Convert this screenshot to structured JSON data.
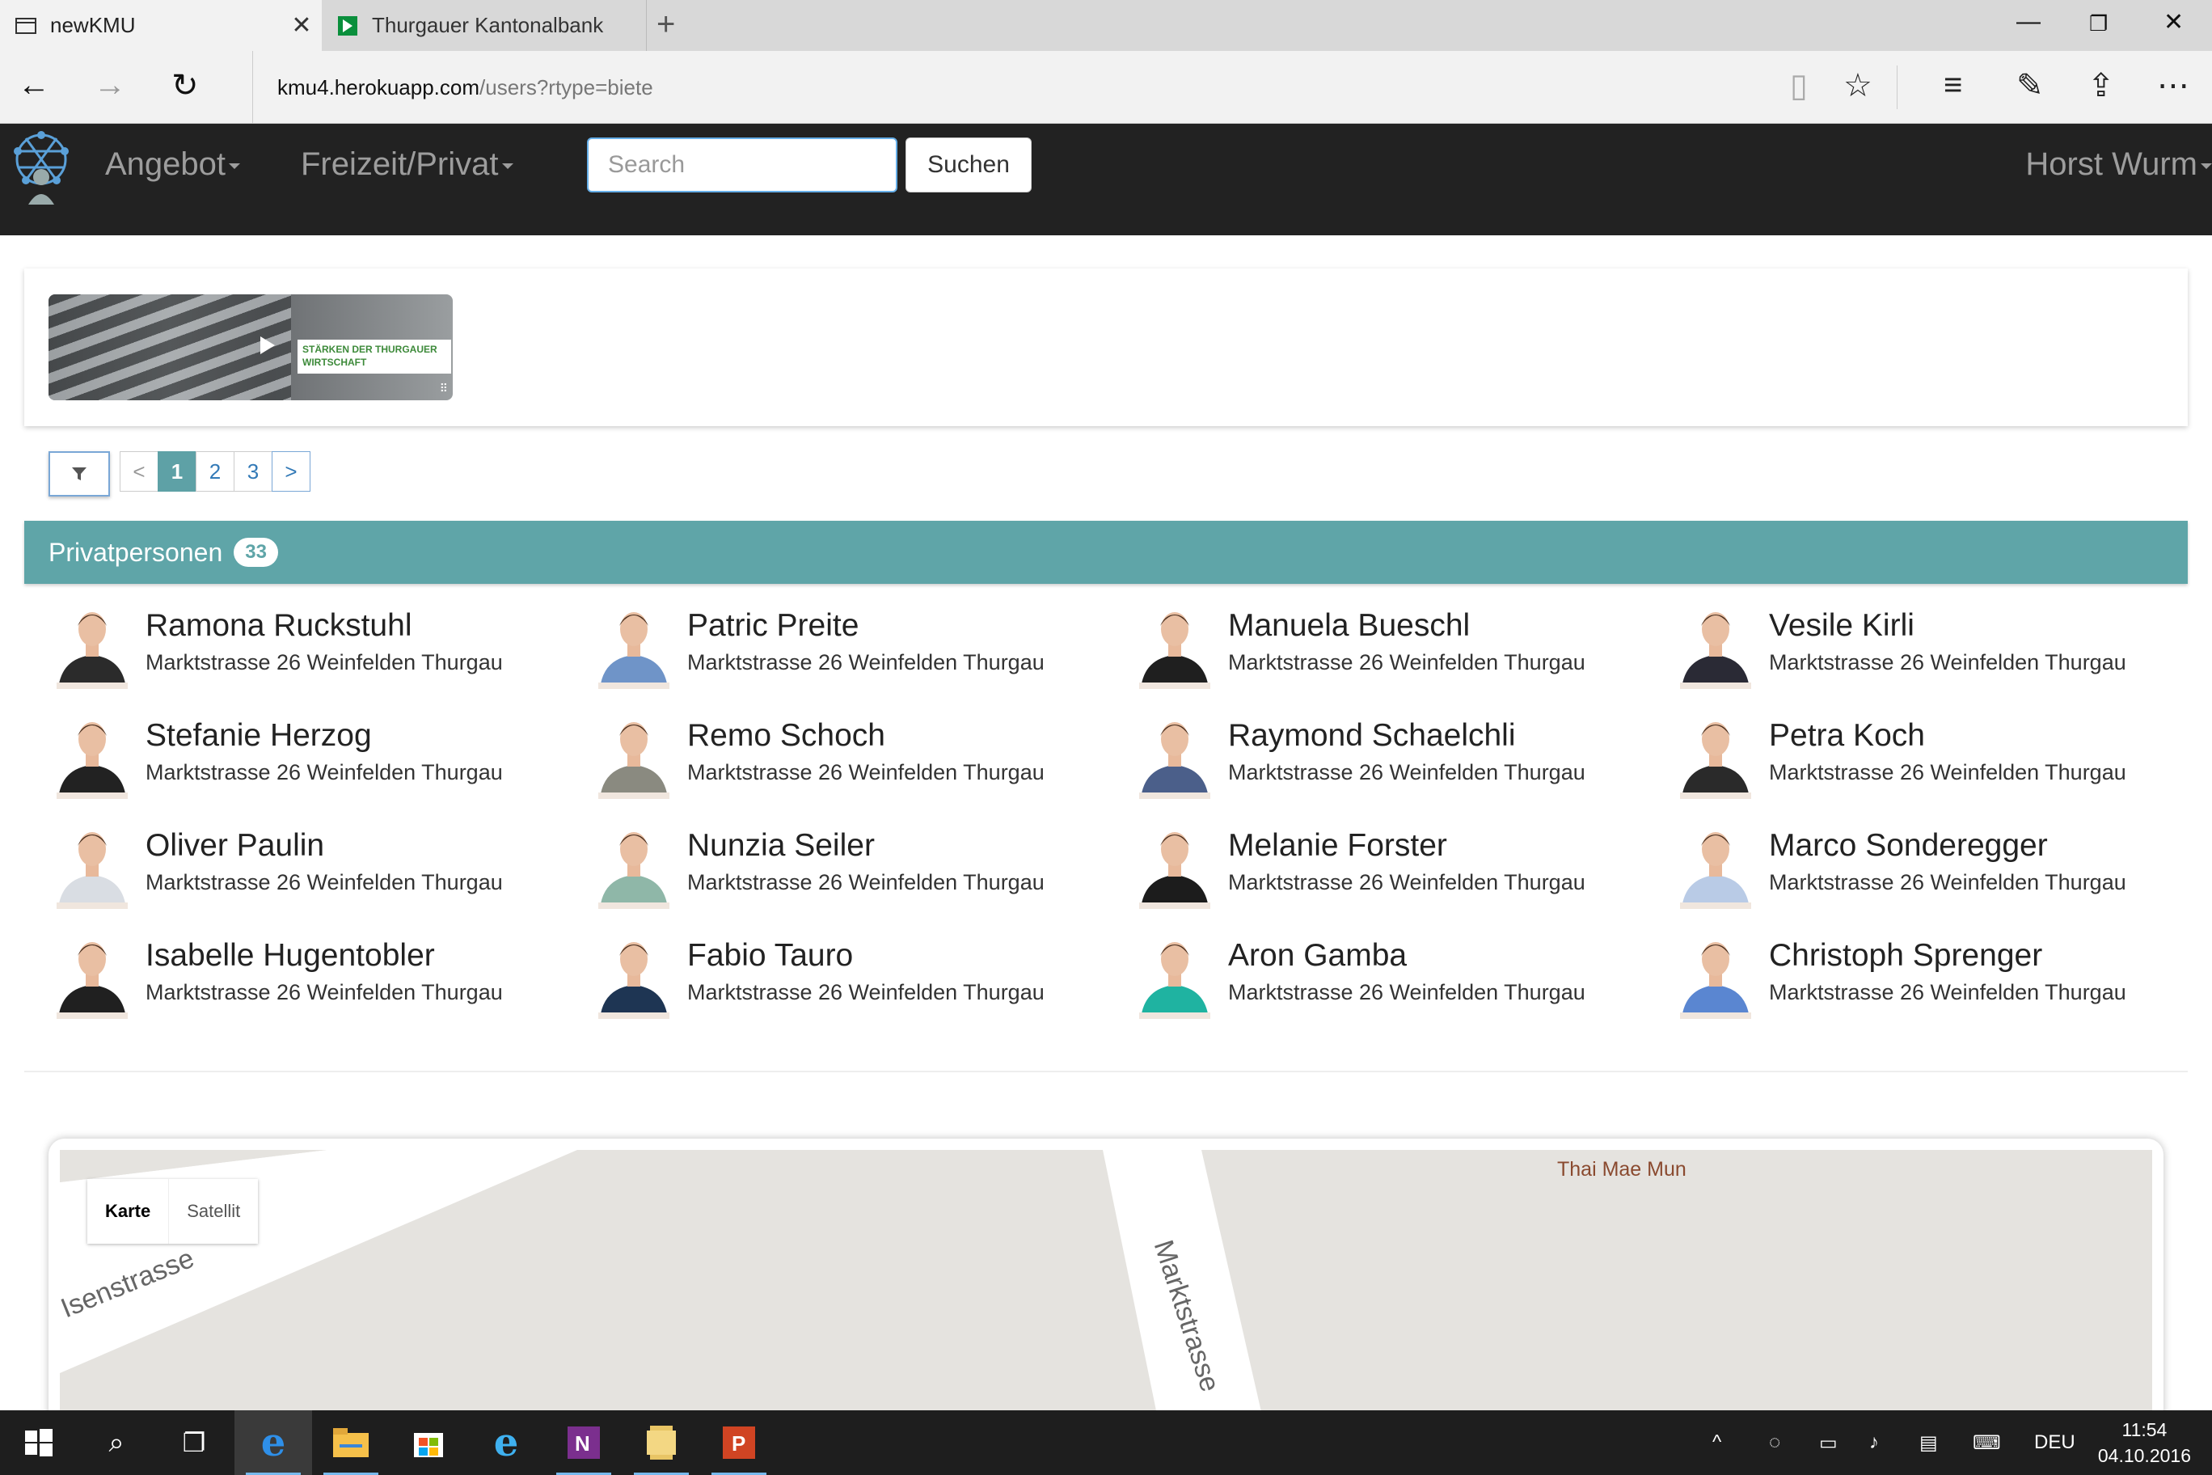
{
  "browser": {
    "tabs": [
      {
        "label": "newKMU",
        "icon": "page-icon",
        "active": true
      },
      {
        "label": "Thurgauer Kantonalbank",
        "icon": "tkb-logo-icon",
        "active": false
      }
    ],
    "url_host": "kmu4.herokuapp.com",
    "url_path": "/users?rtype=biete"
  },
  "navbar": {
    "menu": [
      "Angebot",
      "Freizeit/Privat"
    ],
    "search_placeholder": "Search",
    "search_button": "Suchen",
    "user": "Horst Wurm"
  },
  "banner": {
    "text": "STÄRKEN DER THURGAUER WIRTSCHAFT"
  },
  "pagination": {
    "prev": "<",
    "pages": [
      "1",
      "2",
      "3"
    ],
    "current": "1",
    "next": ">"
  },
  "section": {
    "title": "Privatpersonen",
    "count": "33"
  },
  "people": [
    {
      "name": "Ramona Ruckstuhl",
      "address": "Marktstrasse 26 Weinfelden Thurgau",
      "shirt": "#2b2b2b"
    },
    {
      "name": "Patric Preite",
      "address": "Marktstrasse 26 Weinfelden Thurgau",
      "shirt": "#6f94c8"
    },
    {
      "name": "Manuela Bueschl",
      "address": "Marktstrasse 26 Weinfelden Thurgau",
      "shirt": "#1f1f1f"
    },
    {
      "name": "Vesile Kirli",
      "address": "Marktstrasse 26 Weinfelden Thurgau",
      "shirt": "#2a2a35"
    },
    {
      "name": "Stefanie Herzog",
      "address": "Marktstrasse 26 Weinfelden Thurgau",
      "shirt": "#222222"
    },
    {
      "name": "Remo Schoch",
      "address": "Marktstrasse 26 Weinfelden Thurgau",
      "shirt": "#8a8a80"
    },
    {
      "name": "Raymond Schaelchli",
      "address": "Marktstrasse 26 Weinfelden Thurgau",
      "shirt": "#4b5f8a"
    },
    {
      "name": "Petra Koch",
      "address": "Marktstrasse 26 Weinfelden Thurgau",
      "shirt": "#2a2a2a"
    },
    {
      "name": "Oliver Paulin",
      "address": "Marktstrasse 26 Weinfelden Thurgau",
      "shirt": "#d9dde3"
    },
    {
      "name": "Nunzia Seiler",
      "address": "Marktstrasse 26 Weinfelden Thurgau",
      "shirt": "#8fb7a8"
    },
    {
      "name": "Melanie Forster",
      "address": "Marktstrasse 26 Weinfelden Thurgau",
      "shirt": "#1c1c1c"
    },
    {
      "name": "Marco Sonderegger",
      "address": "Marktstrasse 26 Weinfelden Thurgau",
      "shirt": "#b9cbe6"
    },
    {
      "name": "Isabelle Hugentobler",
      "address": "Marktstrasse 26 Weinfelden Thurgau",
      "shirt": "#202020"
    },
    {
      "name": "Fabio Tauro",
      "address": "Marktstrasse 26 Weinfelden Thurgau",
      "shirt": "#1e3553"
    },
    {
      "name": "Aron Gamba",
      "address": "Marktstrasse 26 Weinfelden Thurgau",
      "shirt": "#1fb3a1"
    },
    {
      "name": "Christoph Sprenger",
      "address": "Marktstrasse 26 Weinfelden Thurgau",
      "shirt": "#5a86d1"
    }
  ],
  "map": {
    "type_buttons": [
      "Karte",
      "Satellit"
    ],
    "streets": [
      "Isenstrasse",
      "Marktstrasse"
    ],
    "poi": "Thai Mae Mun"
  },
  "taskbar": {
    "language": "DEU",
    "time": "11:54",
    "date": "04.10.2016"
  },
  "colors": {
    "teal": "#5fa5a8",
    "navbar": "#222222",
    "link": "#337ab7"
  }
}
